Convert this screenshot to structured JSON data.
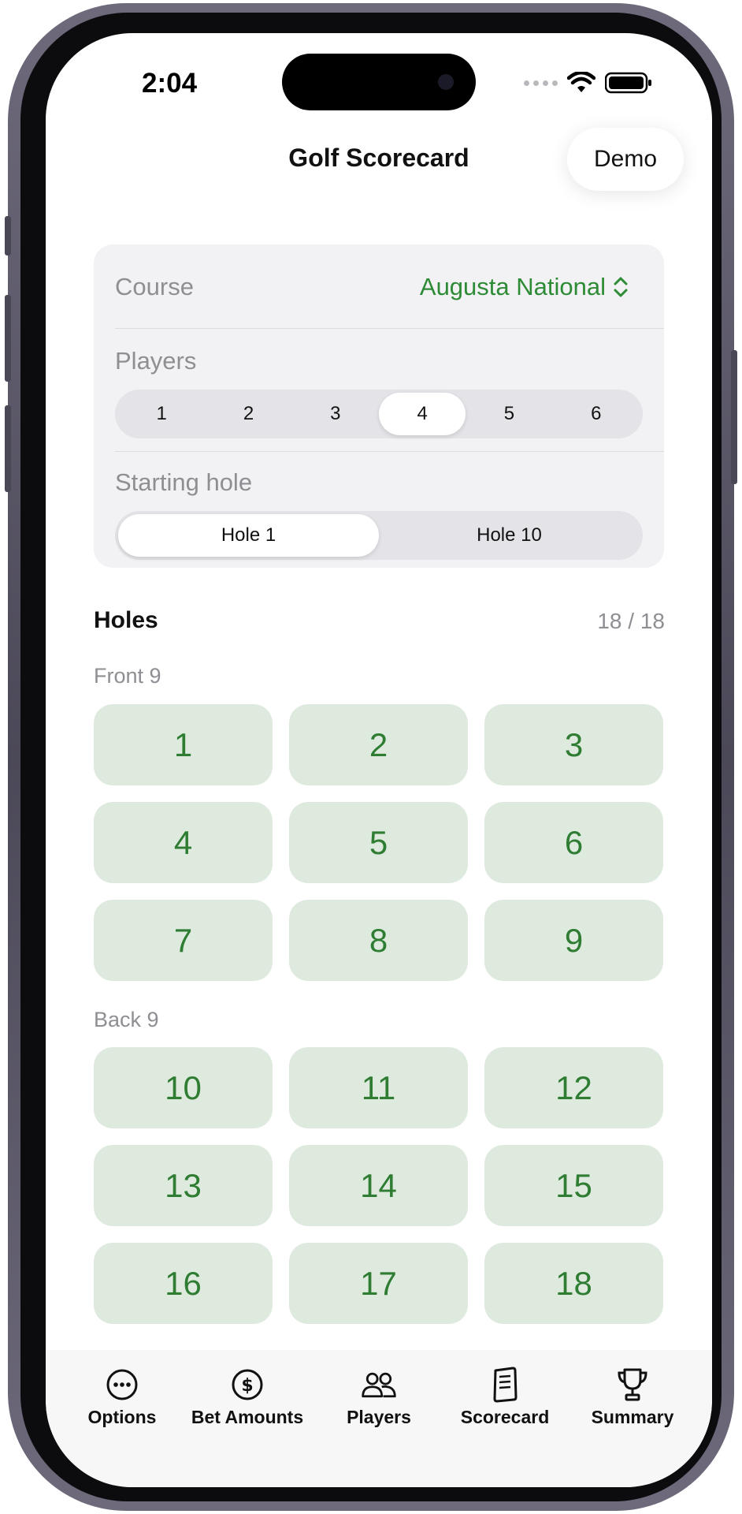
{
  "status": {
    "time": "2:04"
  },
  "nav": {
    "title": "Golf Scorecard",
    "demo_label": "Demo"
  },
  "settings": {
    "course_label": "Course",
    "course_value": "Augusta National",
    "players_label": "Players",
    "player_options": [
      "1",
      "2",
      "3",
      "4",
      "5",
      "6"
    ],
    "players_selected": "4",
    "starting_label": "Starting hole",
    "starting_options": [
      "Hole 1",
      "Hole 10"
    ],
    "starting_selected": "Hole 1"
  },
  "holes": {
    "title": "Holes",
    "count": "18 / 18",
    "front_label": "Front 9",
    "front": [
      "1",
      "2",
      "3",
      "4",
      "5",
      "6",
      "7",
      "8",
      "9"
    ],
    "back_label": "Back 9",
    "back": [
      "10",
      "11",
      "12",
      "13",
      "14",
      "15",
      "16",
      "17",
      "18"
    ]
  },
  "tabs": [
    {
      "label": "Options",
      "icon": "ellipsis-circle-icon"
    },
    {
      "label": "Bet Amounts",
      "icon": "dollar-circle-icon"
    },
    {
      "label": "Players",
      "icon": "people-icon"
    },
    {
      "label": "Scorecard",
      "icon": "scorecard-icon"
    },
    {
      "label": "Summary",
      "icon": "trophy-icon"
    }
  ],
  "colors": {
    "accent": "#2e8b35",
    "hole_bg": "#dfeadf",
    "hole_text": "#2e7d32"
  }
}
